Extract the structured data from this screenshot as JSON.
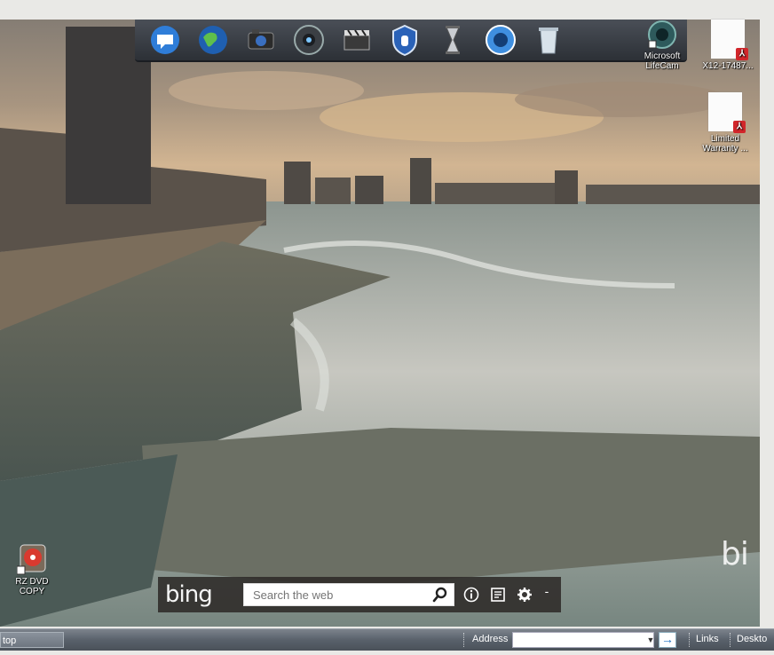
{
  "dock": {
    "icons": [
      {
        "name": "speech-bubble-icon"
      },
      {
        "name": "globe-icon"
      },
      {
        "name": "camera-icon"
      },
      {
        "name": "speaker-icon"
      },
      {
        "name": "clapperboard-icon"
      },
      {
        "name": "security-shield-icon"
      },
      {
        "name": "hourglass-icon"
      },
      {
        "name": "info-orb-icon"
      },
      {
        "name": "recycle-bin-icon"
      }
    ]
  },
  "desktop_icons": [
    {
      "label": "Microsoft LifeCam",
      "icon": "webcam-icon"
    },
    {
      "label": "X12-17487...",
      "icon": "pdf-icon"
    },
    {
      "label": "Limited Warranty ...",
      "icon": "pdf-icon"
    },
    {
      "label": "RZ DVD COPY",
      "icon": "dvd-icon"
    }
  ],
  "bing_bar": {
    "logo": "bing",
    "search_placeholder": "Search the web",
    "buttons": [
      "search-icon",
      "info-icon",
      "news-icon",
      "settings-icon",
      "minimize-icon"
    ],
    "minimize_label": "-"
  },
  "wallpaper_watermark": "bi",
  "taskbar": {
    "left_label": "top",
    "address_label": "Address",
    "address_value": "",
    "go_symbol": "→",
    "links_label": "Links",
    "desktop_label": "Deskto"
  },
  "colors": {
    "bing_bar_bg": "#2d2a28",
    "taskbar": "#59616b",
    "pdf_red": "#d2262b"
  }
}
